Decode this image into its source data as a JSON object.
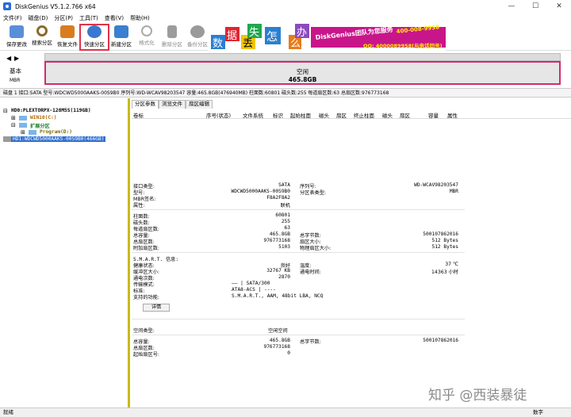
{
  "window": {
    "title": "DiskGenius V5.1.2.766 x64"
  },
  "menu": [
    "文件(F)",
    "磁盘(D)",
    "分区(P)",
    "工具(T)",
    "查看(V)",
    "帮助(H)"
  ],
  "toolbar": [
    {
      "label": "保存更改",
      "icon": "save-icon",
      "color": "#5a8fd8"
    },
    {
      "label": "搜索分区",
      "icon": "magnifier-icon",
      "color": "#8a6b2a"
    },
    {
      "label": "恢复文件",
      "icon": "recover-file-icon",
      "color": "#d97c1e"
    },
    {
      "label": "快速分区",
      "icon": "quick-partition-icon",
      "color": "#3a78d0"
    },
    {
      "label": "新建分区",
      "icon": "new-partition-icon",
      "color": "#3a7fd0"
    },
    {
      "label": "格式化",
      "icon": "format-icon",
      "color": "#aaaaaa"
    },
    {
      "label": "删除分区",
      "icon": "trash-icon",
      "color": "#9c9c9c"
    },
    {
      "label": "备份分区",
      "icon": "backup-icon",
      "color": "#9a9a9a"
    }
  ],
  "ad": {
    "chars": [
      "数",
      "据",
      "丢",
      "失",
      "怎",
      "么",
      "办"
    ],
    "team": "DiskGenius团队为您服务",
    "phone": "400-008-9958",
    "qq": "QQ: 4000089958(与电话同号)"
  },
  "diskbar": {
    "basic": "基本",
    "mbr": "MBR",
    "free_label": "空闲",
    "free_size": "465.8GB"
  },
  "disk_info": "磁盘 1 接口:SATA  型号:WDCWD5000AAKS-00S9B0  序列号:WD-WCAV98203547  容量:465.8GB(476940MB)  柱面数:60801  磁头数:255  每道扇区数:63  总扇区数:976773168",
  "tree": {
    "hd0": "HD0:PLEXTORPX-128M5S(119GB)",
    "win10": "WIN10(C:)",
    "extended": "扩展分区",
    "program": "Program(D:)",
    "hd1": "HD1:WDCWD5000AAKS-00S9B0(466GB)"
  },
  "tabs": [
    "分区参数",
    "浏览文件",
    "扇区编辑"
  ],
  "columns": [
    "卷标",
    "序号(状态)",
    "文件系统",
    "标识",
    "起始柱面",
    "磁头",
    "扇区",
    "终止柱面",
    "磁头",
    "扇区",
    "容量",
    "属性"
  ],
  "details": {
    "left1": [
      [
        "接口类型:",
        "SATA"
      ],
      [
        "型号:",
        "WDCWD5000AAKS-00S9B0"
      ],
      [
        "MBR签名:",
        "F8A2F8A2"
      ],
      [
        "属性:",
        "联机"
      ]
    ],
    "right1": [
      [
        "序列号:",
        "WD-WCAV98203547"
      ],
      [
        "分区表类型:",
        "MBR"
      ]
    ],
    "left2": [
      [
        "柱面数:",
        "60801"
      ],
      [
        "磁头数:",
        "255"
      ],
      [
        "每道扇区数:",
        "63"
      ],
      [
        "总容量:",
        "465.8GB"
      ],
      [
        "总扇区数:",
        "976773168"
      ],
      [
        "附加扇区数:",
        "5103"
      ]
    ],
    "right2": [
      [
        "总字节数:",
        "500107862016"
      ],
      [
        "扇区大小:",
        "512 Bytes"
      ],
      [
        "物理扇区大小:",
        "512 Bytes"
      ]
    ],
    "smart_title": "S.M.A.R.T. 信息:",
    "left3": [
      [
        "健康状态:",
        "良好"
      ],
      [
        "缓冲区大小:",
        "32767 KB"
      ],
      [
        "通电次数:",
        "2870"
      ],
      [
        "传输模式:",
        "—— | SATA/300"
      ],
      [
        "标准:",
        "ATA8-ACS | ----"
      ],
      [
        "支持的功能:",
        "S.M.A.R.T., AAM, 48bit LBA, NCQ"
      ]
    ],
    "right3": [
      [
        "温度:",
        "37 ℃"
      ],
      [
        "通电时间:",
        "14363 小时"
      ]
    ],
    "detail_btn": "详情",
    "left4": [
      [
        "空间类型:",
        "空闲空间"
      ]
    ],
    "left5": [
      [
        "总容量:",
        "465.8GB"
      ],
      [
        "总扇区数:",
        "976773168"
      ],
      [
        "起始扇区号:",
        "0"
      ]
    ],
    "right5": [
      [
        "总字节数:",
        "500107862016"
      ]
    ]
  },
  "status": {
    "left": "就绪",
    "right": "数字"
  },
  "watermark": "知乎 @西装暴徒"
}
